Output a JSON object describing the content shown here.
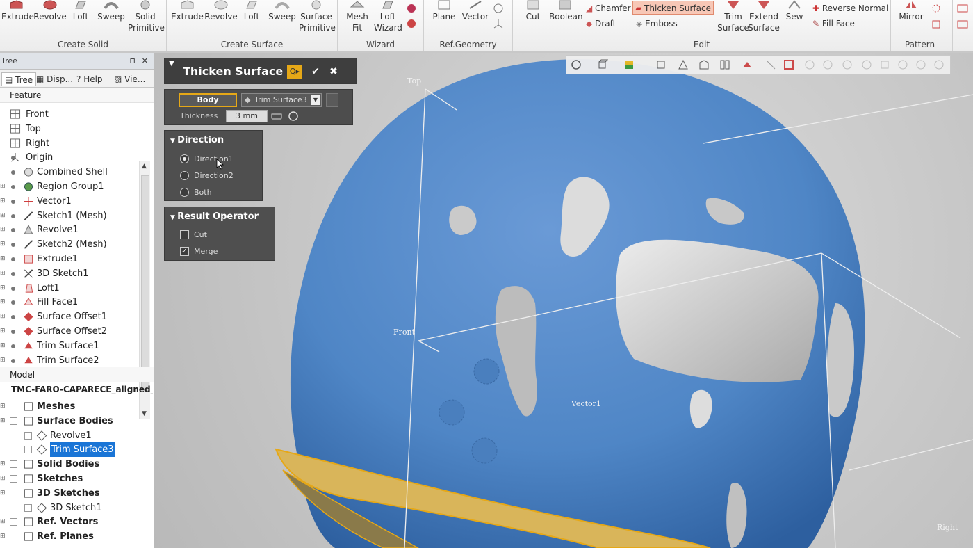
{
  "ribbon": {
    "groups": [
      {
        "name": "create-solid",
        "label": "Create Solid",
        "buttons": [
          {
            "label": "Extrude"
          },
          {
            "label": "Revolve"
          },
          {
            "label": "Loft"
          },
          {
            "label": "Sweep"
          },
          {
            "label": "Solid",
            "label2": "Primitive"
          }
        ]
      },
      {
        "name": "create-surface",
        "label": "Create Surface",
        "buttons": [
          {
            "label": "Extrude"
          },
          {
            "label": "Revolve"
          },
          {
            "label": "Loft"
          },
          {
            "label": "Sweep"
          },
          {
            "label": "Surface",
            "label2": "Primitive"
          }
        ]
      },
      {
        "name": "wizard",
        "label": "Wizard",
        "buttons": [
          {
            "label": "Mesh",
            "label2": "Fit"
          },
          {
            "label": "Loft",
            "label2": "Wizard"
          }
        ]
      },
      {
        "name": "ref-geometry",
        "label": "Ref.Geometry",
        "buttons": [
          {
            "label": "Plane"
          },
          {
            "label": "Vector"
          }
        ]
      },
      {
        "name": "edit",
        "label": "Edit",
        "buttons": [
          {
            "label": "Cut"
          },
          {
            "label": "Boolean"
          }
        ],
        "small": [
          {
            "label": "Chamfer"
          },
          {
            "label": "Draft"
          },
          {
            "label": "Thicken Surface",
            "active": true
          },
          {
            "label": "Emboss"
          },
          {
            "label": "Reverse Normal"
          },
          {
            "label": "Fill Face"
          }
        ],
        "more": [
          {
            "label": "Trim",
            "label2": "Surface"
          },
          {
            "label": "Extend",
            "label2": "Surface"
          },
          {
            "label": "Sew"
          }
        ]
      },
      {
        "name": "pattern",
        "label": "Pattern",
        "buttons": [
          {
            "label": "Mirror"
          }
        ]
      }
    ]
  },
  "tree_panel": {
    "title": "Tree",
    "tabs": [
      "Tree",
      "Disp...",
      "Help",
      "Vie..."
    ],
    "feature_label": "Feature",
    "features": [
      {
        "label": "Front",
        "icon": "plane-icon"
      },
      {
        "label": "Top",
        "icon": "plane-icon"
      },
      {
        "label": "Right",
        "icon": "plane-icon"
      },
      {
        "label": "Origin",
        "icon": "origin-icon"
      },
      {
        "label": "Combined Shell",
        "icon": "shell-icon"
      },
      {
        "label": "Region Group1",
        "icon": "region-group-icon"
      },
      {
        "label": "Vector1",
        "icon": "vector-icon"
      },
      {
        "label": "Sketch1 (Mesh)",
        "icon": "sketch-icon"
      },
      {
        "label": "Revolve1",
        "icon": "revolve-icon"
      },
      {
        "label": "Sketch2 (Mesh)",
        "icon": "sketch-icon"
      },
      {
        "label": "Extrude1",
        "icon": "extrude-icon"
      },
      {
        "label": "3D Sketch1",
        "icon": "sketch3d-icon"
      },
      {
        "label": "Loft1",
        "icon": "loft-icon"
      },
      {
        "label": "Fill Face1",
        "icon": "fill-face-icon"
      },
      {
        "label": "Surface Offset1",
        "icon": "surface-offset-icon"
      },
      {
        "label": "Surface Offset2",
        "icon": "surface-offset-icon"
      },
      {
        "label": "Trim Surface1",
        "icon": "trim-surface-icon"
      },
      {
        "label": "Trim Surface2",
        "icon": "trim-surface-icon"
      }
    ],
    "model_label": "Model",
    "model_name": "TMC-FARO-CAPARECE_aligned_",
    "model_items": [
      {
        "label": "Meshes",
        "bold": true
      },
      {
        "label": "Surface Bodies",
        "bold": true
      },
      {
        "label": "Revolve1",
        "child": true
      },
      {
        "label": "Trim Surface3",
        "child": true,
        "selected": true
      },
      {
        "label": "Solid Bodies",
        "bold": true
      },
      {
        "label": "Sketches",
        "bold": true
      },
      {
        "label": "3D Sketches",
        "bold": true
      },
      {
        "label": "3D Sketch1",
        "child": true
      },
      {
        "label": "Ref. Vectors",
        "bold": true
      },
      {
        "label": "Ref. Planes",
        "bold": true
      }
    ]
  },
  "dialog": {
    "title": "Thicken Surface",
    "body_button": "Body",
    "body_selection": "Trim Surface3",
    "thickness_label": "Thickness",
    "thickness_value": "3 mm",
    "direction_title": "Direction",
    "directions": [
      {
        "label": "Direction1",
        "selected": true
      },
      {
        "label": "Direction2",
        "selected": false
      },
      {
        "label": "Both",
        "selected": false
      }
    ],
    "result_title": "Result Operator",
    "results": [
      {
        "label": "Cut",
        "checked": false
      },
      {
        "label": "Merge",
        "checked": true
      }
    ]
  },
  "viewport": {
    "labels": {
      "top": "Top",
      "front": "Front",
      "right": "Right",
      "vector": "Vector1"
    },
    "colors": {
      "body": "#4f86c6",
      "highlight": "#e6a817",
      "background": "#c4c4c4"
    }
  }
}
